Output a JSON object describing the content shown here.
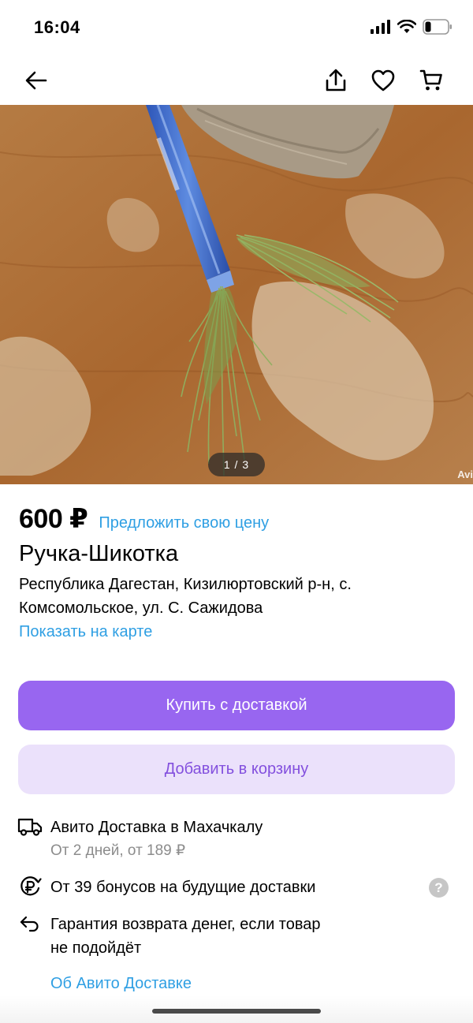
{
  "status_bar": {
    "time": "16:04"
  },
  "nav": {
    "back_icon": "arrow-left-icon",
    "share_icon": "share-icon",
    "favorite_icon": "heart-icon",
    "cart_icon": "cart-icon"
  },
  "photo": {
    "counter": "1 / 3",
    "watermark": "Avi"
  },
  "listing": {
    "price": "600 ₽",
    "offer_link": "Предложить свою цену",
    "title": "Ручка-Шикотка",
    "address_line1": "Республика Дагестан, Кизилюртовский р-н, с.",
    "address_line2": "Комсомольское, ул. С. Сажидова",
    "map_link": "Показать на карте"
  },
  "actions": {
    "buy_label": "Купить с доставкой",
    "cart_label": "Добавить в корзину"
  },
  "delivery": {
    "service_title": "Авито Доставка в Махачкалу",
    "service_sub": "От 2 дней, от 189 ₽",
    "bonus_text": "От 39 бонусов на будущие доставки",
    "guarantee_line1": "Гарантия возврата денег, если товар",
    "guarantee_line2": "не подойдёт",
    "about_link": "Об Авито Доставке",
    "help_glyph": "?"
  },
  "colors": {
    "accent_purple": "#9866f0",
    "accent_purple_light": "#ebe1fb",
    "link_blue": "#2f9fe3"
  }
}
